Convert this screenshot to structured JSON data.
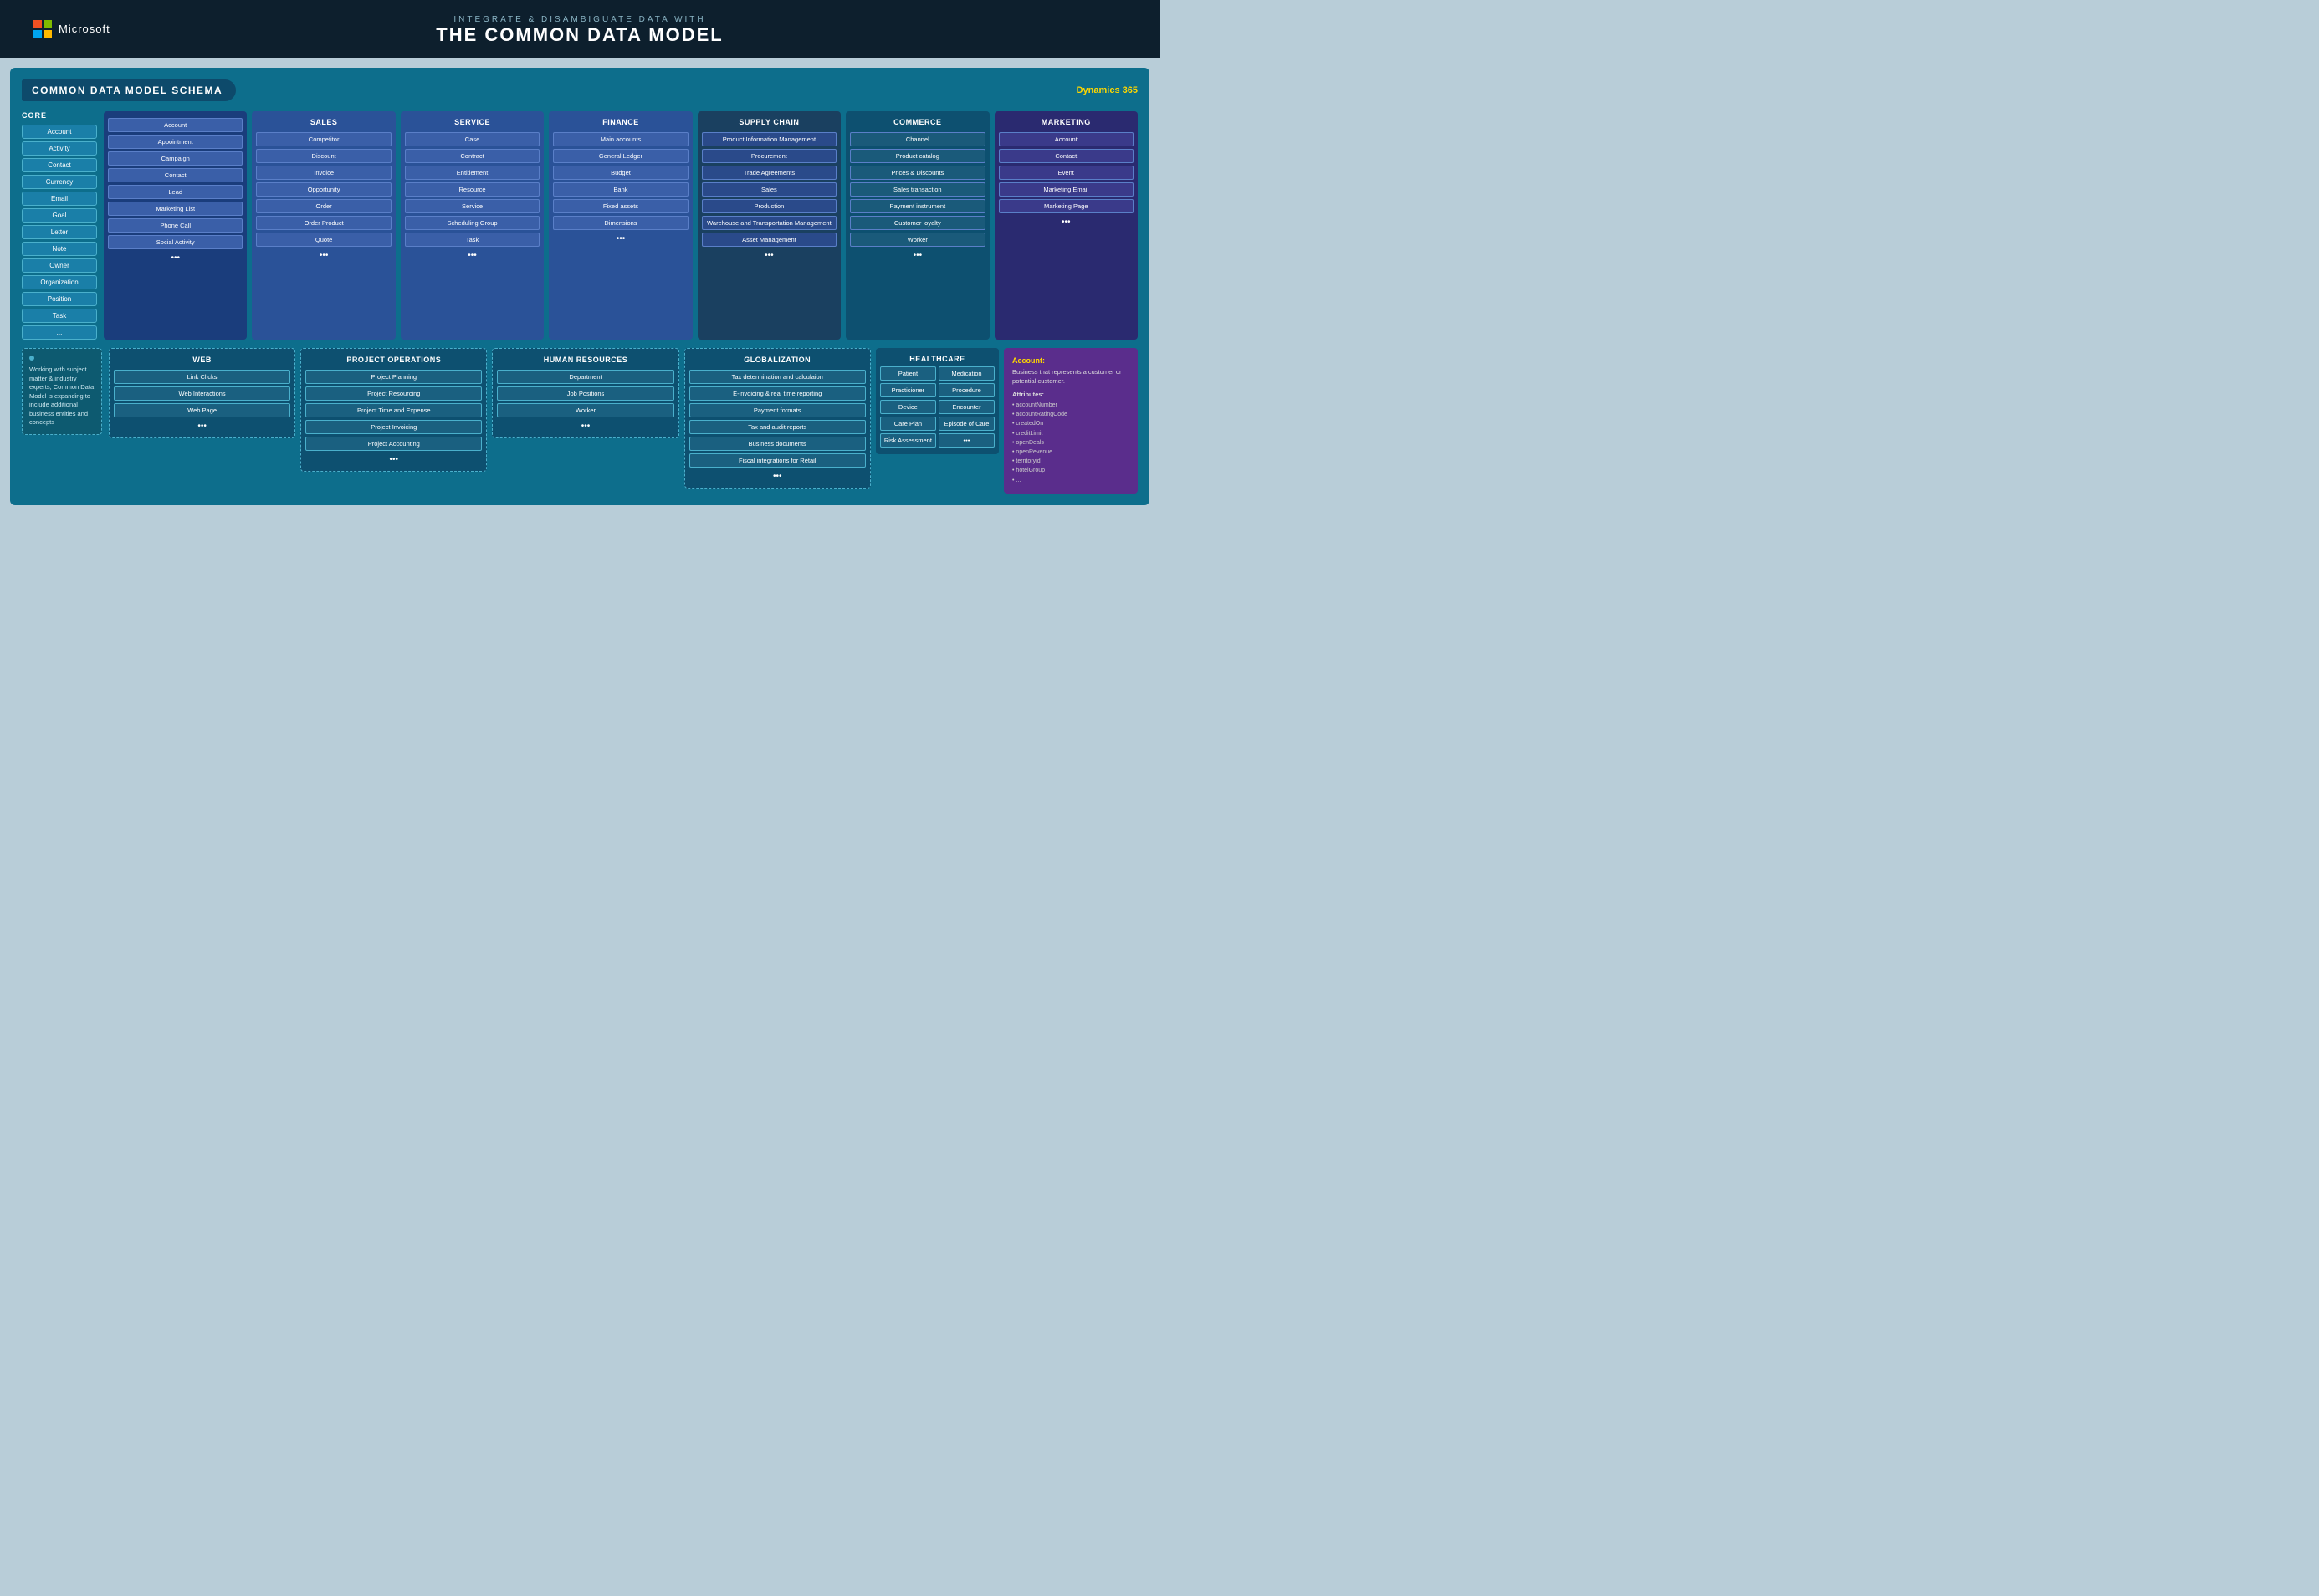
{
  "header": {
    "subtitle": "INTEGRATE & DISAMBIGUATE DATA WITH",
    "title": "THE COMMON DATA MODEL",
    "logo_text": "Microsoft"
  },
  "schema": {
    "title": "COMMON DATA MODEL SCHEMA",
    "dynamics_label": "Dynamics 365"
  },
  "core": {
    "label": "CORE",
    "items": [
      "Account",
      "Activity",
      "Contact",
      "Currency",
      "Email",
      "Goal",
      "Letter",
      "Note",
      "Owner",
      "Organization",
      "Position",
      "Task",
      "..."
    ]
  },
  "modules": {
    "base": {
      "items": [
        "Account",
        "Appointment",
        "Campaign",
        "Contact",
        "Lead",
        "Marketing List",
        "Phone Call",
        "Social Activity",
        "..."
      ]
    },
    "sales": {
      "title": "SALES",
      "items": [
        "Competitor",
        "Discount",
        "Invoice",
        "Opportunity",
        "Order",
        "Order Product",
        "Quote",
        "..."
      ]
    },
    "service": {
      "title": "SERVICE",
      "items": [
        "Case",
        "Contract",
        "Entitlement",
        "Resource",
        "Service",
        "Scheduling Group",
        "Task",
        "..."
      ]
    },
    "finance": {
      "title": "FINANCE",
      "items": [
        "Main accounts",
        "General Ledger",
        "Budget",
        "Bank",
        "Fixed assets",
        "Dimensions",
        "..."
      ]
    },
    "supply_chain": {
      "title": "SUPPLY CHAIN",
      "items": [
        "Product Information Management",
        "Procurement",
        "Trade Agreements",
        "Sales",
        "Production",
        "Warehouse and Transportation Management",
        "Asset Management",
        "..."
      ]
    },
    "commerce": {
      "title": "COMMERCE",
      "items": [
        "Channel",
        "Product catalog",
        "Prices & Discounts",
        "Sales transaction",
        "Payment instrument",
        "Customer loyalty",
        "Worker",
        "..."
      ]
    },
    "marketing": {
      "title": "MARKETING",
      "items": [
        "Account",
        "Contact",
        "Event",
        "Marketing Email",
        "Marketing Page",
        "..."
      ]
    }
  },
  "bottom_modules": {
    "web": {
      "title": "WEB",
      "items": [
        "Link Clicks",
        "Web Interactions",
        "Web Page",
        "..."
      ]
    },
    "project_ops": {
      "title": "PROJECT OPERATIONS",
      "items": [
        "Project Planning",
        "Project Resourcing",
        "Project Time and Expense",
        "Project Invoicing",
        "Project Accounting",
        "..."
      ]
    },
    "human_resources": {
      "title": "HUMAN RESOURCES",
      "items": [
        "Department",
        "Job Positions",
        "Worker",
        "..."
      ]
    },
    "globalization": {
      "title": "GLOBALIZATION",
      "items": [
        "Tax determination and calculaion",
        "E-invoicing & real time reporting",
        "Payment formats",
        "Tax and audit reports",
        "Business documents",
        "Fiscal integrations for Retail",
        "..."
      ]
    }
  },
  "healthcare": {
    "title": "HEALTHCARE",
    "left_items": [
      "Patient",
      "Practicioner",
      "Device",
      "Care Plan",
      "Risk Assessment"
    ],
    "right_items": [
      "Medication",
      "Procedure",
      "Encounter",
      "Episode of Care",
      "..."
    ]
  },
  "expand_note": "Working with subject matter & industry experts, Common Data Model is expanding to include additional business entities and concepts",
  "account_popup": {
    "title": "Account:",
    "description": "Business that represents a customer or potential customer.",
    "attributes_label": "Attributes:",
    "attributes": [
      "accountNumber",
      "accountRatingCode",
      "createdOn",
      "creditLimit",
      "openDeals",
      "openRevenue",
      "territoryid",
      "hotelGroup",
      "..."
    ]
  }
}
